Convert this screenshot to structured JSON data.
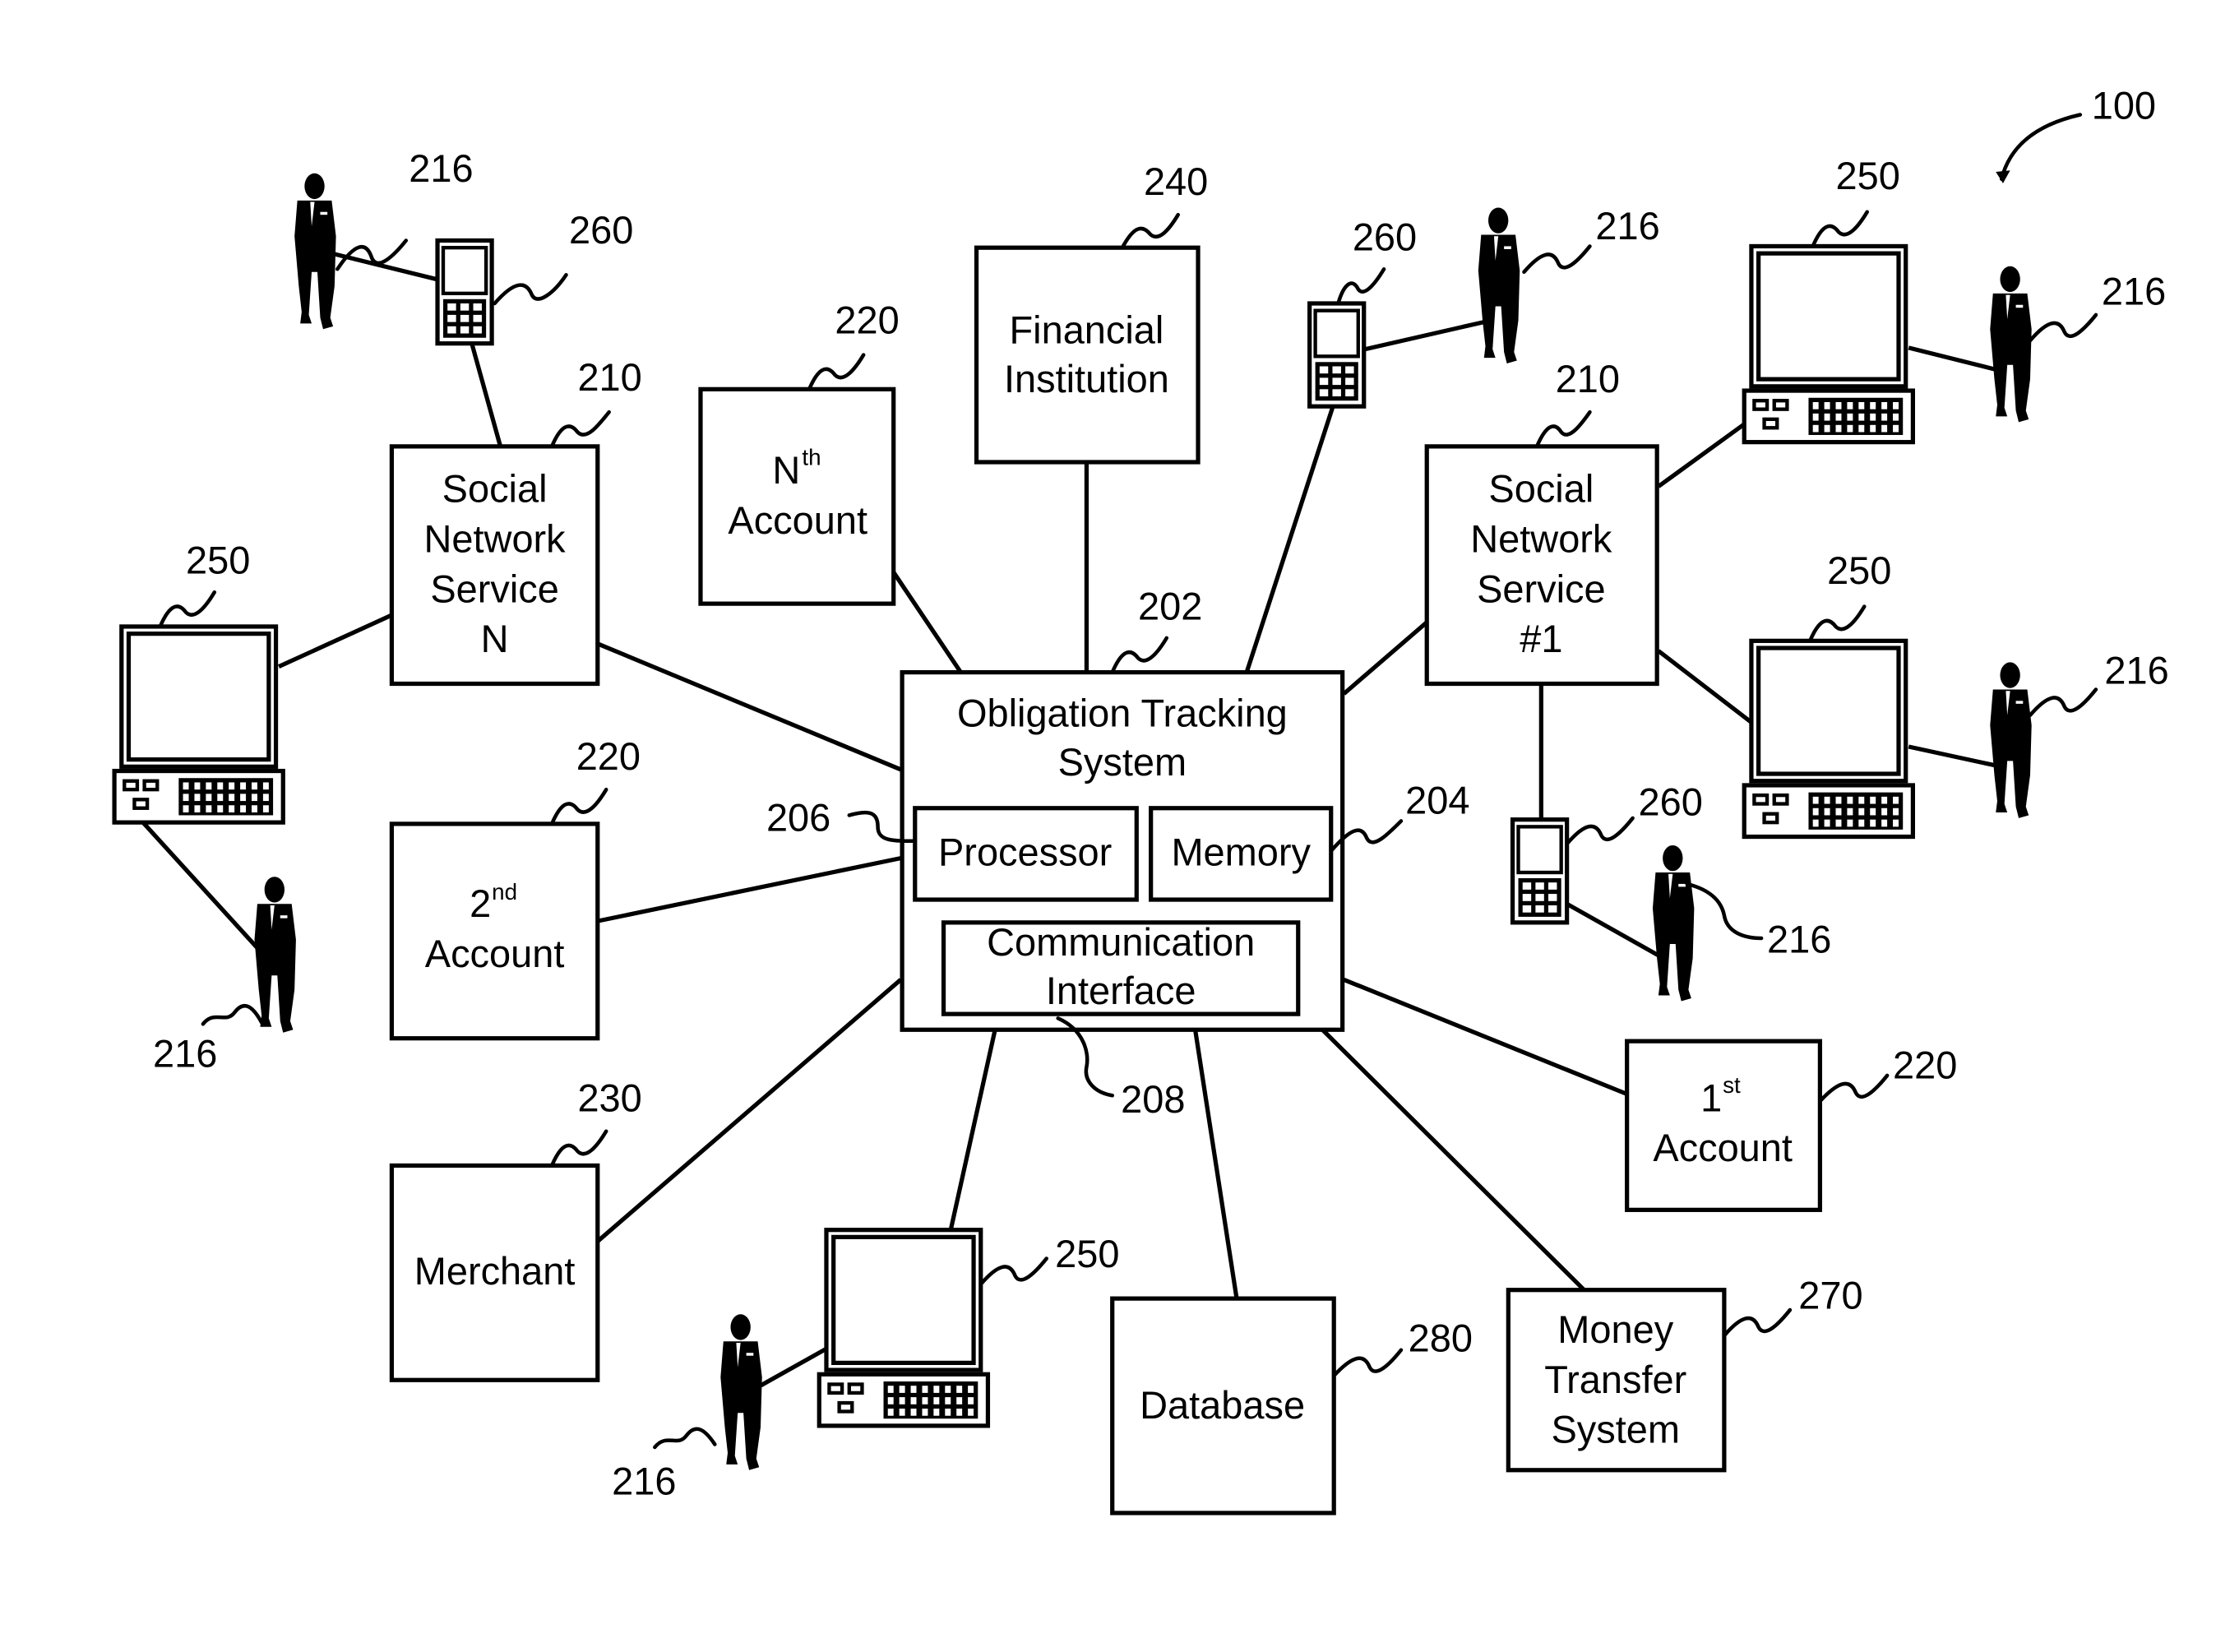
{
  "figure_ref": "100",
  "central": {
    "title_lines": [
      "Obligation Tracking",
      "System"
    ],
    "ref": "202",
    "processor": {
      "label": "Processor",
      "ref": "206"
    },
    "memory": {
      "label": "Memory",
      "ref": "204"
    },
    "comm": {
      "lines": [
        "Communication",
        "Interface"
      ],
      "ref": "208"
    }
  },
  "financial_institution": {
    "lines": [
      "Financial",
      "Institution"
    ],
    "ref": "240"
  },
  "nth_account": {
    "num": "N",
    "sup": "th",
    "word": "Account",
    "ref": "220"
  },
  "second_account": {
    "num": "2",
    "sup": "nd",
    "word": "Account",
    "ref": "220"
  },
  "first_account": {
    "num": "1",
    "sup": "st",
    "word": "Account",
    "ref": "220"
  },
  "sns_n": {
    "lines": [
      "Social",
      "Network",
      "Service",
      "N"
    ],
    "ref": "210"
  },
  "sns_1": {
    "lines": [
      "Social",
      "Network",
      "Service",
      "#1"
    ],
    "ref": "210"
  },
  "merchant": {
    "label": "Merchant",
    "ref": "230"
  },
  "database": {
    "label": "Database",
    "ref": "280"
  },
  "money_transfer": {
    "lines": [
      "Money",
      "Transfer",
      "System"
    ],
    "ref": "270"
  },
  "refs": {
    "user": "216",
    "computer": "250",
    "phone": "260"
  }
}
